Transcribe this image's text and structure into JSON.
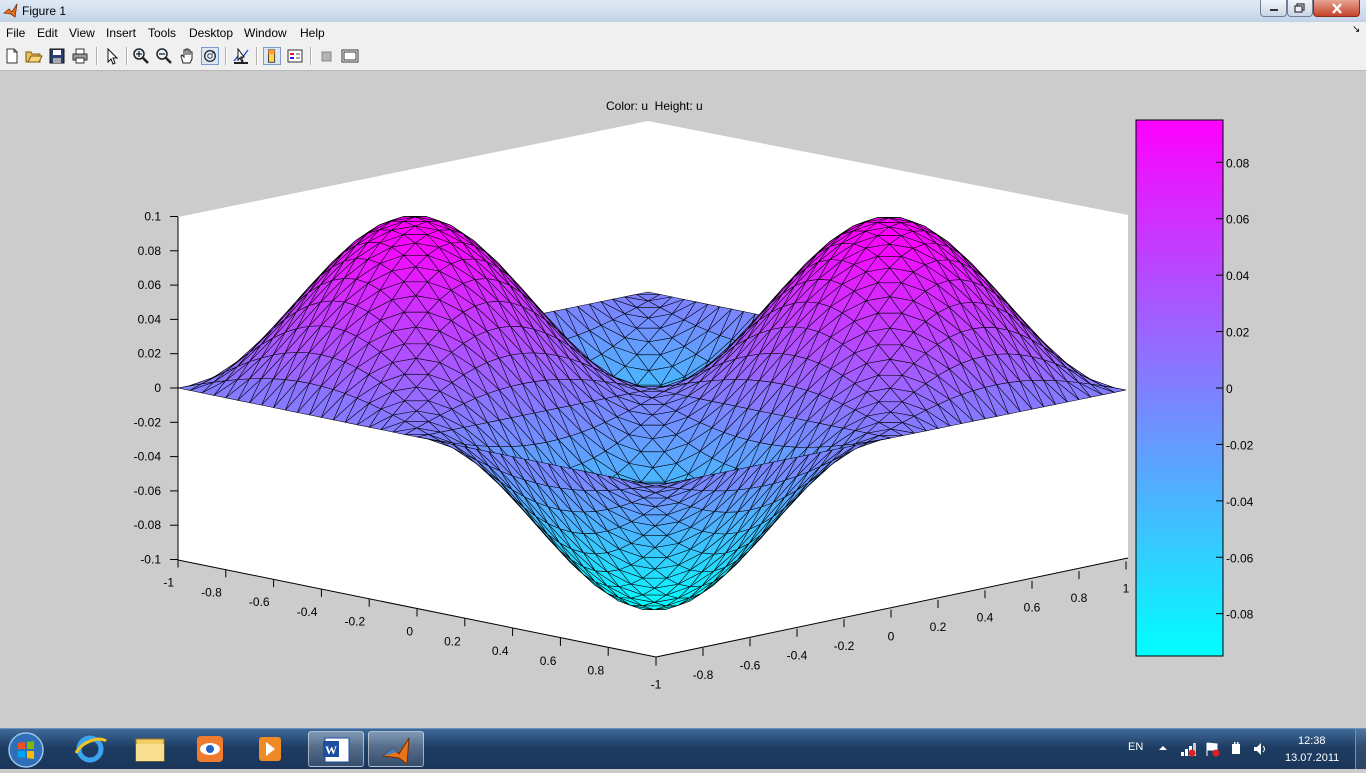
{
  "window": {
    "title": "Figure 1"
  },
  "menu": [
    "File",
    "Edit",
    "View",
    "Insert",
    "Tools",
    "Desktop",
    "Window",
    "Help"
  ],
  "plot": {
    "title": "Color: u  Height: u",
    "z_ticks": [
      "0.1",
      "0.08",
      "0.06",
      "0.04",
      "0.02",
      "0",
      "-0.02",
      "-0.04",
      "-0.06",
      "-0.08",
      "-0.1"
    ],
    "x_ticks": [
      "-1",
      "-0.8",
      "-0.6",
      "-0.4",
      "-0.2",
      "0",
      "0.2",
      "0.4",
      "0.6",
      "0.8"
    ],
    "y_ticks": [
      "-1",
      "-0.8",
      "-0.6",
      "-0.4",
      "-0.2",
      "0",
      "0.2",
      "0.4",
      "0.6",
      "0.8",
      "1"
    ],
    "colorbar_ticks": [
      "0.08",
      "0.06",
      "0.04",
      "0.02",
      "0",
      "-0.02",
      "-0.04",
      "-0.06",
      "-0.08"
    ],
    "colormap": [
      "#00ffff",
      "#ff00ff"
    ]
  },
  "chart_data": {
    "type": "surface",
    "title": "Color: u  Height: u",
    "x_range": [
      -1,
      1
    ],
    "y_range": [
      -1,
      1
    ],
    "z_range": [
      -0.1,
      0.1
    ],
    "color_range": [
      -0.095,
      0.095
    ],
    "colormap": "cool",
    "description": "u = 0.1·sin(pi·x)·sin(pi·y) over a triangular mesh"
  },
  "taskbar": {
    "language": "EN",
    "time": "12:38",
    "date": "13.07.2011"
  }
}
